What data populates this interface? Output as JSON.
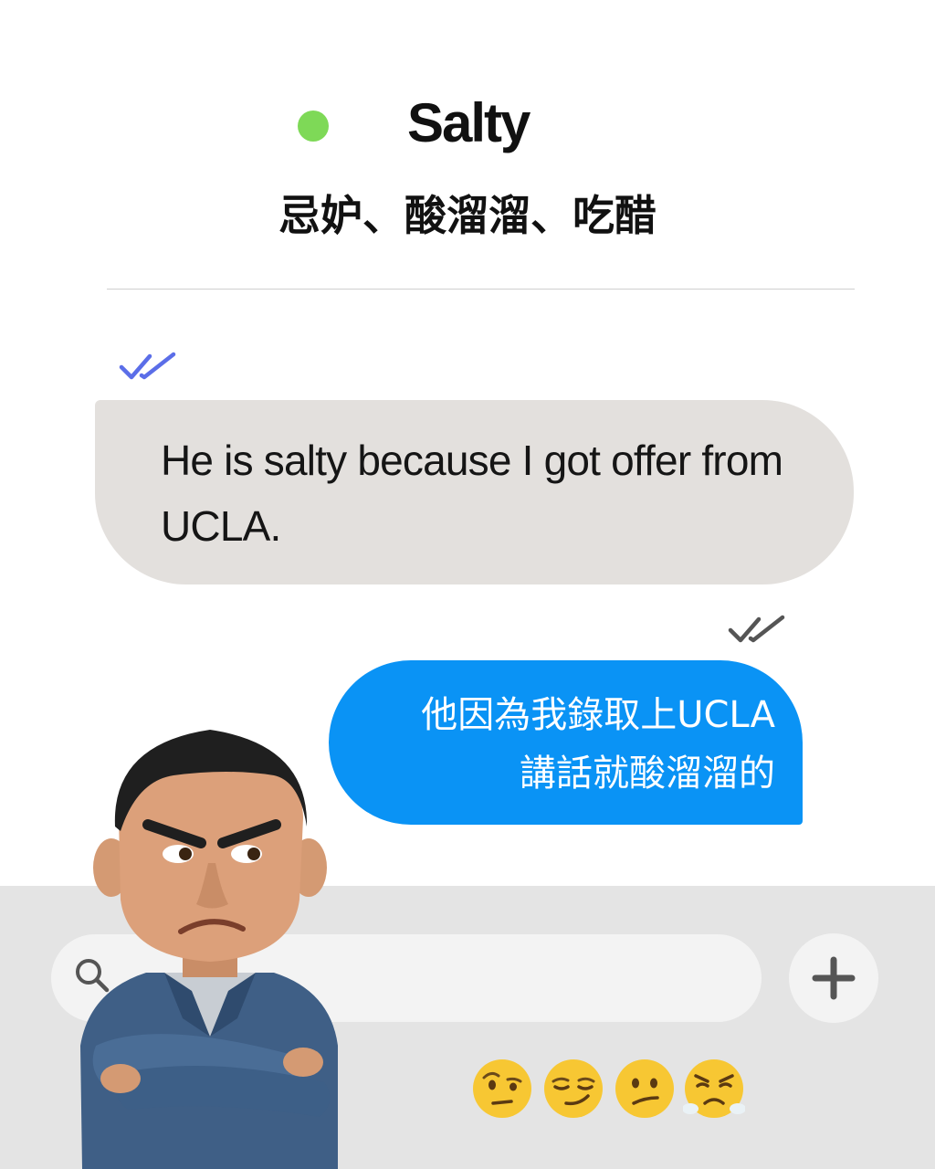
{
  "header": {
    "status_color": "#7ed957",
    "title": "Salty",
    "subtitle": "忌妒、酸溜溜、吃醋"
  },
  "messages": [
    {
      "direction": "incoming",
      "status_icon": "double-check-icon",
      "status_color": "#5b6ee8",
      "text": "He is salty because I got offer from UCLA.",
      "bubble_color": "#e3e0dd"
    },
    {
      "direction": "outgoing",
      "status_icon": "double-check-icon",
      "status_color": "#555555",
      "lines": [
        "他因為我錄取上UCLA",
        "講話就酸溜溜的"
      ],
      "bubble_color": "#0a93f5"
    }
  ],
  "input_bar": {
    "search_icon": "search-icon",
    "add_icon": "plus-icon"
  },
  "emoji_row": [
    "🤨",
    "😏",
    "😕",
    "😤"
  ],
  "character": "angry-man-arms-crossed-illustration"
}
